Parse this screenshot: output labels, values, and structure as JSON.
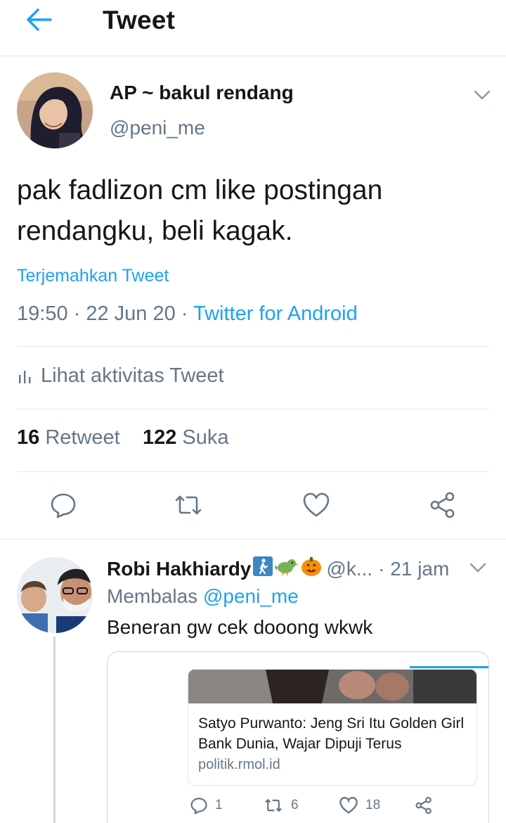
{
  "header": {
    "title": "Tweet"
  },
  "tweet": {
    "author_name": "AP ~ bakul rendang",
    "author_handle": "@peni_me",
    "text": "pak fadlizon cm like postingan rendangku, beli kagak.",
    "translate_label": "Terjemahkan Tweet",
    "time": "19:50",
    "date": "22 Jun 20",
    "source": "Twitter for Android",
    "activity_label": "Lihat aktivitas Tweet",
    "retweet_count": "16",
    "retweet_label": "Retweet",
    "like_count": "122",
    "like_label": "Suka",
    "actions": [
      "reply-icon",
      "retweet-icon",
      "like-icon",
      "share-icon"
    ]
  },
  "reply": {
    "author_name": "Robi Hakhiardy",
    "emojis": [
      "person-walking-icon",
      "bird-icon",
      "pumpkin-icon"
    ],
    "author_handle": "@k...",
    "time": "21 jam",
    "replying_label": "Membalas",
    "replying_to": "@peni_me",
    "text": "Beneran gw cek dooong wkwk",
    "quoted": {
      "title": "Satyo Purwanto: Jeng Sri Itu Golden Girl Bank Dunia, Wajar Dipuji Terus",
      "domain": "politik.rmol.id"
    },
    "reply_count": "1",
    "retweet_count": "6",
    "like_count": "18"
  },
  "colors": {
    "accent": "#1da1f2",
    "muted": "#657786",
    "text": "#14171a",
    "divider": "#e1e8ed"
  }
}
